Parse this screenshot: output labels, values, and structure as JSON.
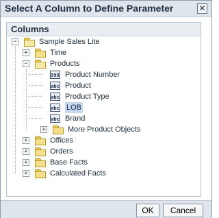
{
  "dialog": {
    "title": "Select A Column to Define Parameter",
    "close_glyph": "✕",
    "panel_title": "Columns"
  },
  "tree": {
    "root": "Sample Sales Lite",
    "time": "Time",
    "products": "Products",
    "product_number": "Product Number",
    "product": "Product",
    "product_type": "Product Type",
    "lob": "LOB",
    "brand": "Brand",
    "more_product_objects": "More Product Objects",
    "offices": "Offices",
    "orders": "Orders",
    "base_facts": "Base Facts",
    "calculated_facts": "Calculated Facts",
    "number_icon": "999",
    "text_icon": "abc",
    "collapse_glyph": "−",
    "expand_glyph": "+"
  },
  "buttons": {
    "ok": "OK",
    "cancel": "Cancel"
  },
  "colors": {
    "titlebar": "#dfe5ec",
    "selection": "#c5d7f0",
    "folder": "#f4e08a"
  }
}
